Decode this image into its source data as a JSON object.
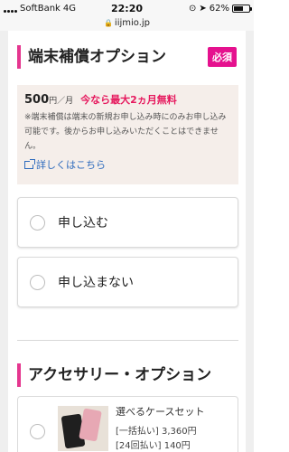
{
  "status_bar": {
    "carrier": "SoftBank",
    "network": "4G",
    "time": "22:20",
    "battery": "62%",
    "battery_level": 0.62
  },
  "url_bar": {
    "domain": "iijmio.jp",
    "lock_icon": "lock-icon"
  },
  "device_option": {
    "title": "端末補償オプション",
    "required_badge": "必須",
    "price": "500",
    "price_unit": "円／月",
    "promo": "今なら最大2ヵ月無料",
    "note": "※端末補償は端末の新規お申し込み時にのみお申し込み可能です。後からお申し込みいただくことはできません。",
    "details_link": "詳しくはこちら",
    "choices": [
      {
        "label": "申し込む",
        "selected": false
      },
      {
        "label": "申し込まない",
        "selected": false
      }
    ]
  },
  "accessory_option": {
    "title": "アクセサリー・オプション",
    "product": {
      "name": "選べるケースセット",
      "lump_sum": "[一括払い] 3,360円",
      "installment": "[24回払い] 140円"
    }
  },
  "colors": {
    "accent": "#e5368f",
    "badge": "#e5118e",
    "promo": "#e6195e",
    "link": "#2e6bbd",
    "info_bg": "#f5eeea"
  }
}
